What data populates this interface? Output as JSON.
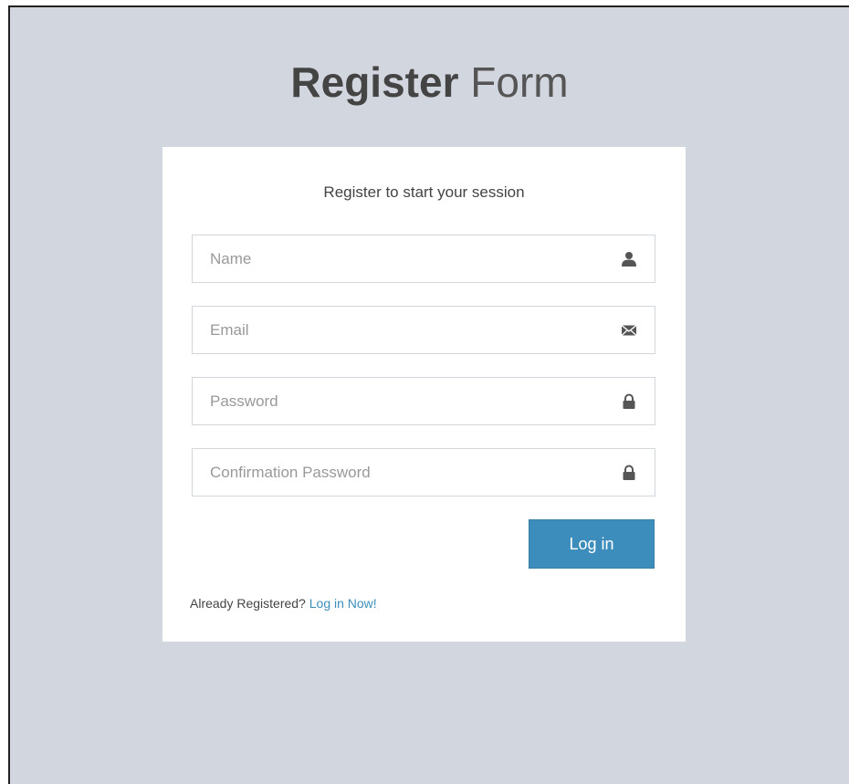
{
  "page": {
    "title_bold": "Register",
    "title_light": "Form"
  },
  "form": {
    "subtitle": "Register to start your session",
    "fields": [
      {
        "placeholder": "Name",
        "value": "",
        "icon": "user-icon"
      },
      {
        "placeholder": "Email",
        "value": "",
        "icon": "envelope-icon"
      },
      {
        "placeholder": "Password",
        "value": "",
        "icon": "lock-icon"
      },
      {
        "placeholder": "Confirmation Password",
        "value": "",
        "icon": "lock-icon"
      }
    ],
    "submit_label": "Log in",
    "footer_text": "Already Registered?",
    "footer_link": "Log in Now!"
  },
  "colors": {
    "background": "#d2d6de",
    "card": "#ffffff",
    "accent": "#3c8dbc",
    "icon": "#555555"
  }
}
